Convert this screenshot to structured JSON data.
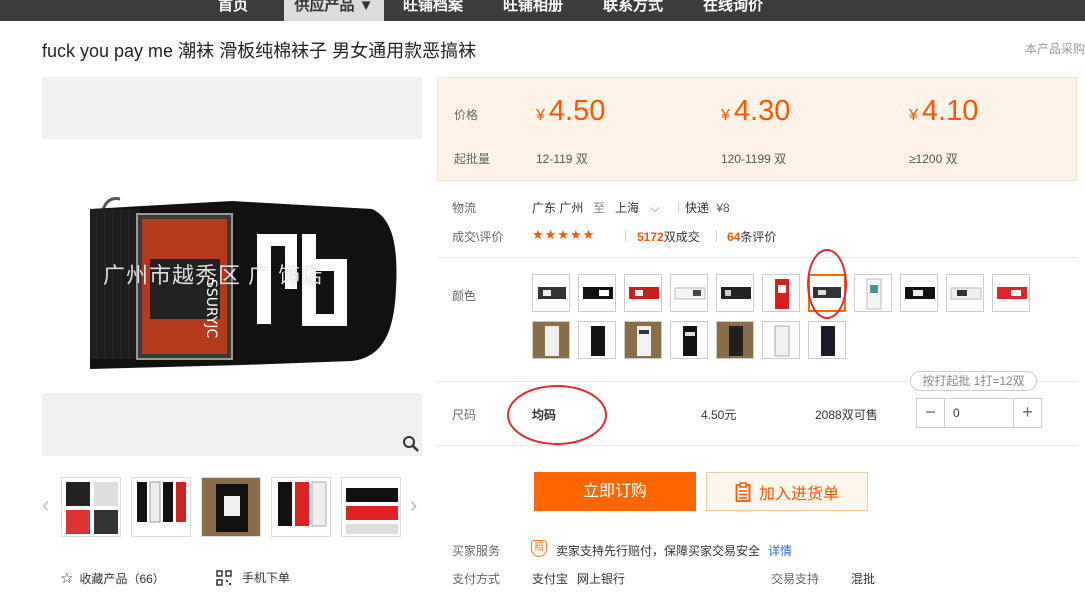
{
  "nav": {
    "items": [
      "首页",
      "供应产品 ▼",
      "旺铺档案",
      "旺铺相册",
      "联系方式",
      "在线询价"
    ],
    "active_index": 1
  },
  "product": {
    "title": "fuck you pay me 潮袜 滑板纯棉袜子 男女通用款恶搞袜",
    "purchase_note": "本产品采购"
  },
  "gallery": {
    "watermark": "广州市越秀区 广 饰店",
    "zoom_icon": "search-icon",
    "prev_icon": "chevron-left-icon",
    "next_icon": "chevron-right-icon"
  },
  "pricing": {
    "price_label": "价格",
    "moq_label": "起批量",
    "currency": "¥",
    "tiers": [
      {
        "price": "4.50",
        "range": "12-119 双"
      },
      {
        "price": "4.30",
        "range": "120-1199 双"
      },
      {
        "price": "4.10",
        "range": "≥1200 双"
      }
    ]
  },
  "logistics": {
    "label": "物流",
    "from": "广东 广州",
    "to_word": "至",
    "to": "上海",
    "method": "快递",
    "fee": "¥8"
  },
  "deals": {
    "label": "成交\\评价",
    "stars": "★★★★★",
    "count": "5172",
    "count_suffix": "双成交",
    "reviews": "64",
    "reviews_suffix": "条评价"
  },
  "color": {
    "label": "颜色",
    "selected_index": 6
  },
  "size": {
    "label": "尺码",
    "batch_tip": "按打起批 1打=12双",
    "name": "均码",
    "price": "4.50元",
    "stock": "2088双可售",
    "quantity": "0",
    "minus": "−",
    "plus": "+"
  },
  "actions": {
    "order": "立即订购",
    "cart": "加入进货单"
  },
  "service": {
    "label": "买家服务",
    "text": "卖家支持先行赔付，保障买家交易安全",
    "link": "详情",
    "badge": "赔"
  },
  "payment": {
    "label": "支付方式",
    "methods": [
      "支付宝",
      "网上银行"
    ],
    "trade_label": "交易支持",
    "trade_value": "混批"
  },
  "bottom": {
    "favorite": "收藏产品（66）",
    "mobile": "手机下单"
  },
  "colors": {
    "accent": "#ff5500",
    "button": "#ff6600",
    "annotation": "#e8272e"
  }
}
